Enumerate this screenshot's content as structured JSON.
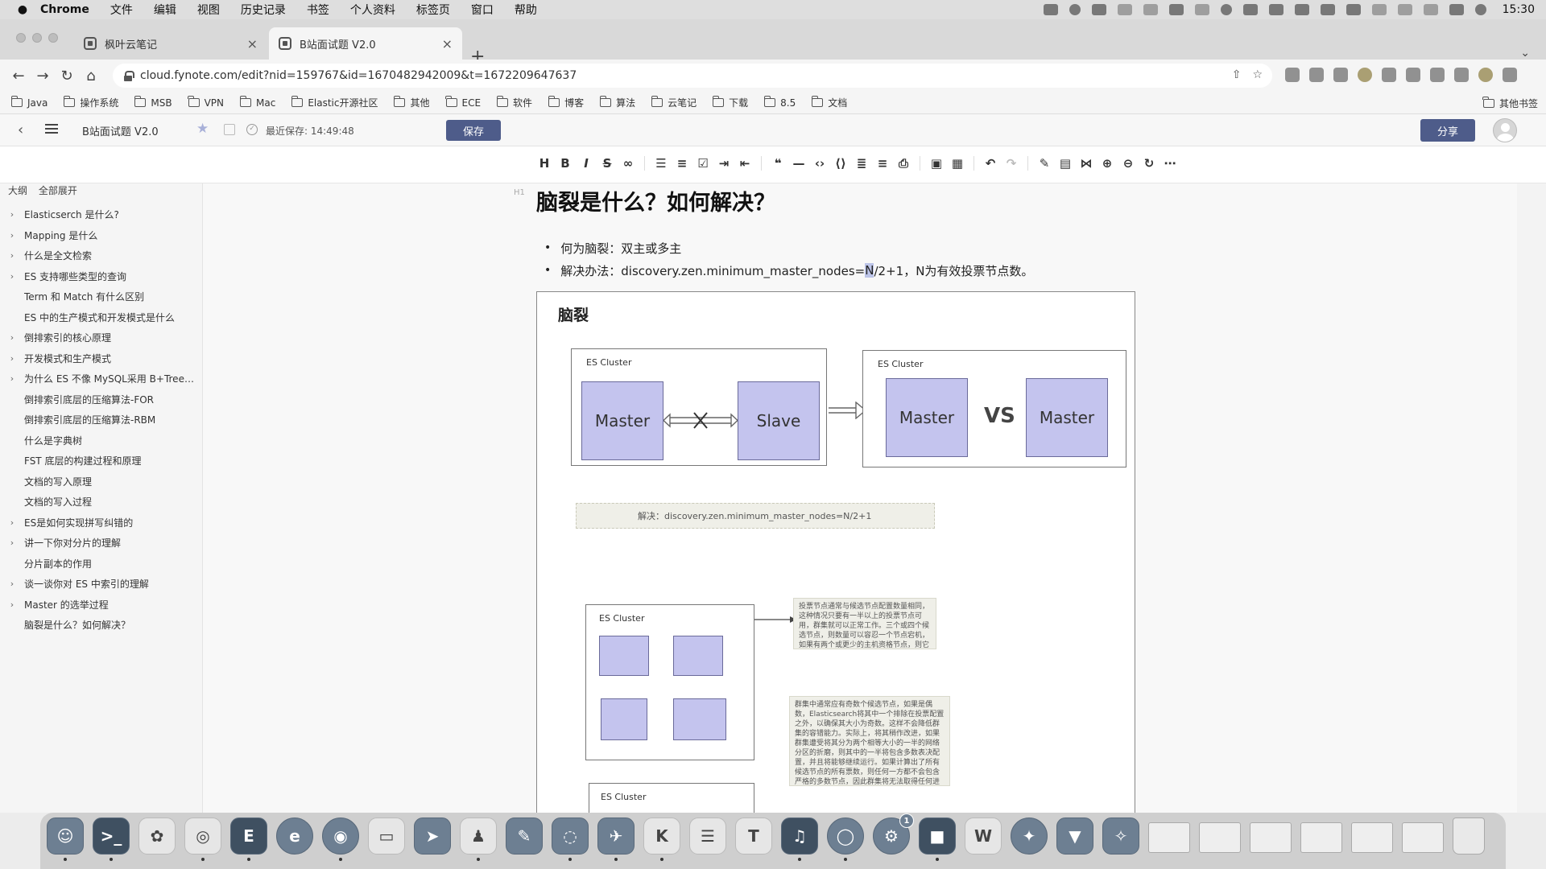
{
  "menubar": {
    "app": "Chrome",
    "items": [
      "文件",
      "编辑",
      "视图",
      "历史记录",
      "书签",
      "个人资料",
      "标签页",
      "窗口",
      "帮助"
    ],
    "clock": "15:30"
  },
  "tabs": [
    {
      "label": "枫叶云笔记"
    },
    {
      "label": "B站面试题 V2.0"
    }
  ],
  "address": {
    "url": "cloud.fynote.com/edit?nid=159767&id=1670482942009&t=1672209647637"
  },
  "bookmarks": {
    "items": [
      "Java",
      "操作系统",
      "MSB",
      "VPN",
      "Mac",
      "Elastic开源社区",
      "其他",
      "ECE",
      "软件",
      "博客",
      "算法",
      "云笔记",
      "下载",
      "8.5",
      "文档"
    ],
    "other": "其他书签"
  },
  "header": {
    "title": "B站面试题 V2.0",
    "saved": "最近保存: 14:49:48",
    "save_label": "保存",
    "share_label": "分享"
  },
  "sidebar": {
    "outline_label": "大纲",
    "expand_label": "全部展开",
    "items": [
      {
        "label": "Elasticserch 是什么?",
        "has_children": true
      },
      {
        "label": "Mapping 是什么",
        "has_children": true
      },
      {
        "label": "什么是全文检索",
        "has_children": true
      },
      {
        "label": "ES 支持哪些类型的查询",
        "has_children": true
      },
      {
        "label": "Term 和 Match 有什么区别",
        "has_children": false
      },
      {
        "label": "ES 中的生产模式和开发模式是什么",
        "has_children": false
      },
      {
        "label": "倒排索引的核心原理",
        "has_children": true
      },
      {
        "label": "开发模式和生产模式",
        "has_children": true
      },
      {
        "label": "为什么 ES 不像 MySQL采用 B+Trees...",
        "has_children": true
      },
      {
        "label": "倒排索引底层的压缩算法-FOR",
        "has_children": false
      },
      {
        "label": "倒排索引底层的压缩算法-RBM",
        "has_children": false
      },
      {
        "label": "什么是字典树",
        "has_children": false
      },
      {
        "label": "FST 底层的构建过程和原理",
        "has_children": false
      },
      {
        "label": "文档的写入原理",
        "has_children": false
      },
      {
        "label": "文档的写入过程",
        "has_children": false
      },
      {
        "label": "ES是如何实现拼写纠错的",
        "has_children": true
      },
      {
        "label": "讲一下你对分片的理解",
        "has_children": true
      },
      {
        "label": "分片副本的作用",
        "has_children": false
      },
      {
        "label": "谈一谈你对 ES 中索引的理解",
        "has_children": true
      },
      {
        "label": "Master 的选举过程",
        "has_children": true
      },
      {
        "label": "脑裂是什么？如何解决？",
        "has_children": false
      }
    ]
  },
  "content": {
    "heading_tag": "H1",
    "heading": "脑裂是什么？如何解决？",
    "bullet1": "何为脑裂：双主或多主",
    "bullet2_pre": "解决办法：discovery.zen.minimum_master_nodes=",
    "bullet2_sel": "N",
    "bullet2_post": "/2+1，N为有效投票节点数。"
  },
  "diagram": {
    "title": "脑裂",
    "cluster_label": "ES Cluster",
    "left_master": "Master",
    "left_slave": "Slave",
    "right_master_a": "Master",
    "vs": "VS",
    "right_master_b": "Master",
    "solve": "解决：discovery.zen.minimum_master_nodes=N/2+1",
    "note1": "投票节点通常与候选节点配置数量相同，这种情况只要有一半以上的投票节点可用，群集就可以正常工作。三个或四个候选节点，则数量可以容忍一个节点宕机，如果有两个或更少的主机资格节点，则它们必须都保持可用",
    "note2": "群集中通常应有奇数个候选节点，如果是偶数，Elasticsearch将其中一个排除在投票配置之外，以确保其大小为奇数。这样不会降低群集的容错能力。实际上，将其稍作改进，如果群集遭受将其分为两个相等大小的一半的网络分区的折磨，则其中的一半将包含多数表决配置，并且将能够继续运行。如果计算出了所有候选节点的所有票数，则任何一方都不会包含严格的多数节点，因此群集将无法取得任何进展"
  },
  "dock": {
    "badge": "1",
    "editor_letter": "T"
  }
}
